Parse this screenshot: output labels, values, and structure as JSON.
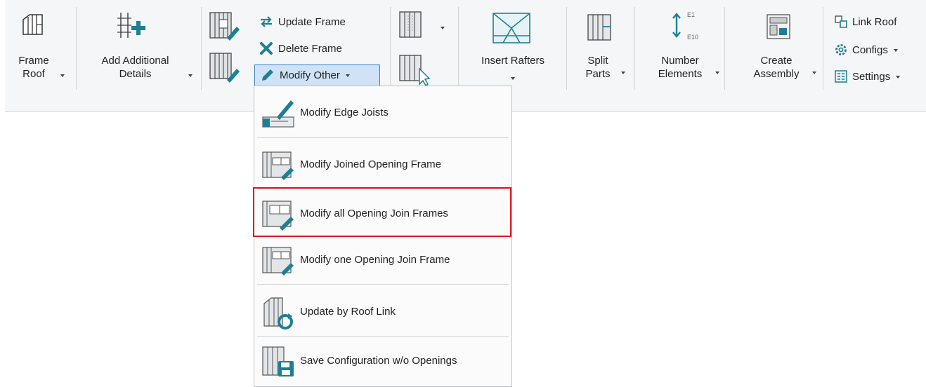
{
  "ribbon": {
    "frame_roof": {
      "line1": "Frame",
      "line2": "Roof"
    },
    "add_details": {
      "line1": "Add Additional",
      "line2": "Details"
    },
    "update_frame": "Update Frame",
    "delete_frame": "Delete Frame",
    "modify_other": "Modify Other",
    "insert_rafters": "Insert Rafters",
    "split_parts": {
      "line1": "Split",
      "line2": "Parts"
    },
    "number_elements": {
      "line1": "Number",
      "line2": "Elements",
      "badge_top": "E1",
      "badge_bottom": "E10"
    },
    "create_assembly": {
      "line1": "Create",
      "line2": "Assembly"
    },
    "link_roof": "Link Roof",
    "configs": "Configs",
    "settings": "Settings"
  },
  "menu": {
    "items": [
      {
        "label": "Modify Edge Joists"
      },
      {
        "label": "Modify Joined Opening Frame"
      },
      {
        "label": "Modify all Opening Join Frames"
      },
      {
        "label": "Modify one Opening Join Frame"
      },
      {
        "label": "Update by Roof Link"
      },
      {
        "label": "Save Configuration w/o Openings"
      }
    ]
  },
  "colors": {
    "accent": "#1e7f94",
    "highlight_border": "#e0181f",
    "pressed_button": "#cfe2f6"
  }
}
